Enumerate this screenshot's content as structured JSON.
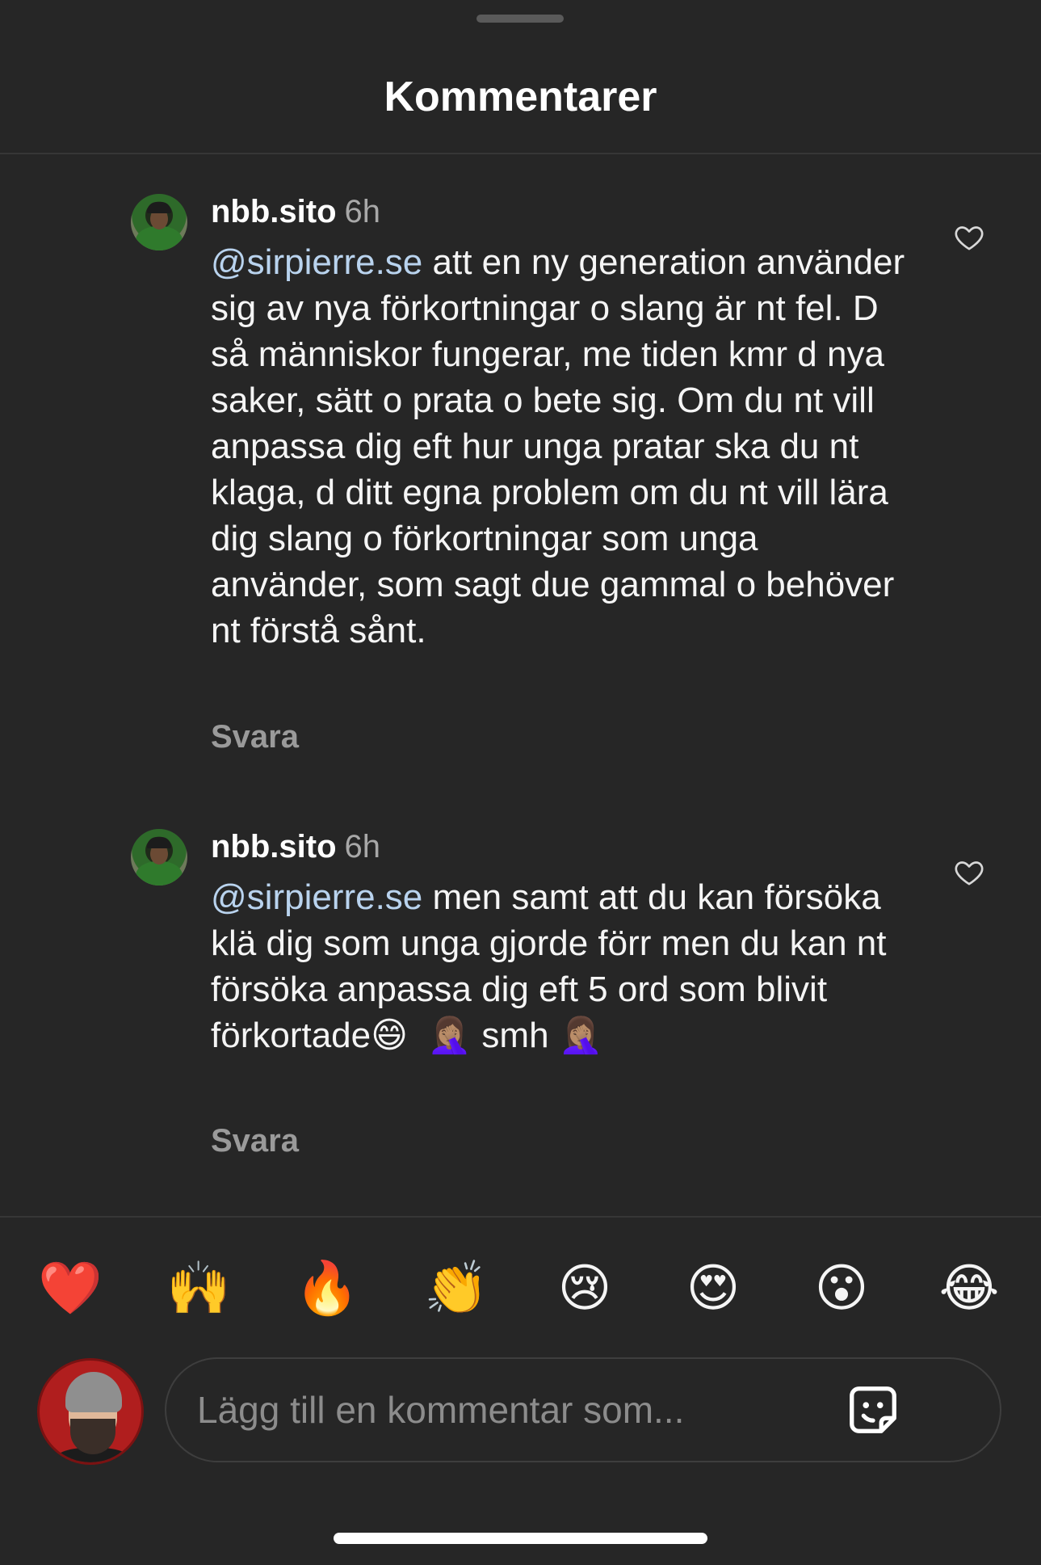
{
  "header": {
    "title": "Kommentarer"
  },
  "comments": [
    {
      "username": "nbb.sito",
      "time": "6h",
      "mention": "@sirpierre.se",
      "text": " att en ny generation använder sig av nya förkortningar o slang är nt fel. D så människor fungerar, me tiden kmr d nya saker, sätt o prata o bete sig. Om du nt vill anpassa dig eft hur unga pratar ska du nt klaga, d ditt egna problem om du nt vill lära dig slang o förkortningar som unga använder, som sagt due gammal o behöver nt förstå sånt.",
      "reply_label": "Svara"
    },
    {
      "username": "nbb.sito",
      "time": "6h",
      "mention": "@sirpierre.se",
      "text": " men samt att du kan försöka klä dig som unga gjorde förr men du kan nt försöka anpassa dig eft 5 ord som blivit förkortade😄  🤦🏽‍♀️ smh 🤦🏽‍♀️",
      "reply_label": "Svara"
    }
  ],
  "quick_reactions": [
    "❤️",
    "🙌",
    "🔥",
    "👏",
    "😢",
    "😍",
    "😮",
    "😂"
  ],
  "composer": {
    "placeholder": "Lägg till en kommentar som..."
  },
  "icons": {
    "like": "heart-outline-icon",
    "sticker": "sticker-icon"
  }
}
